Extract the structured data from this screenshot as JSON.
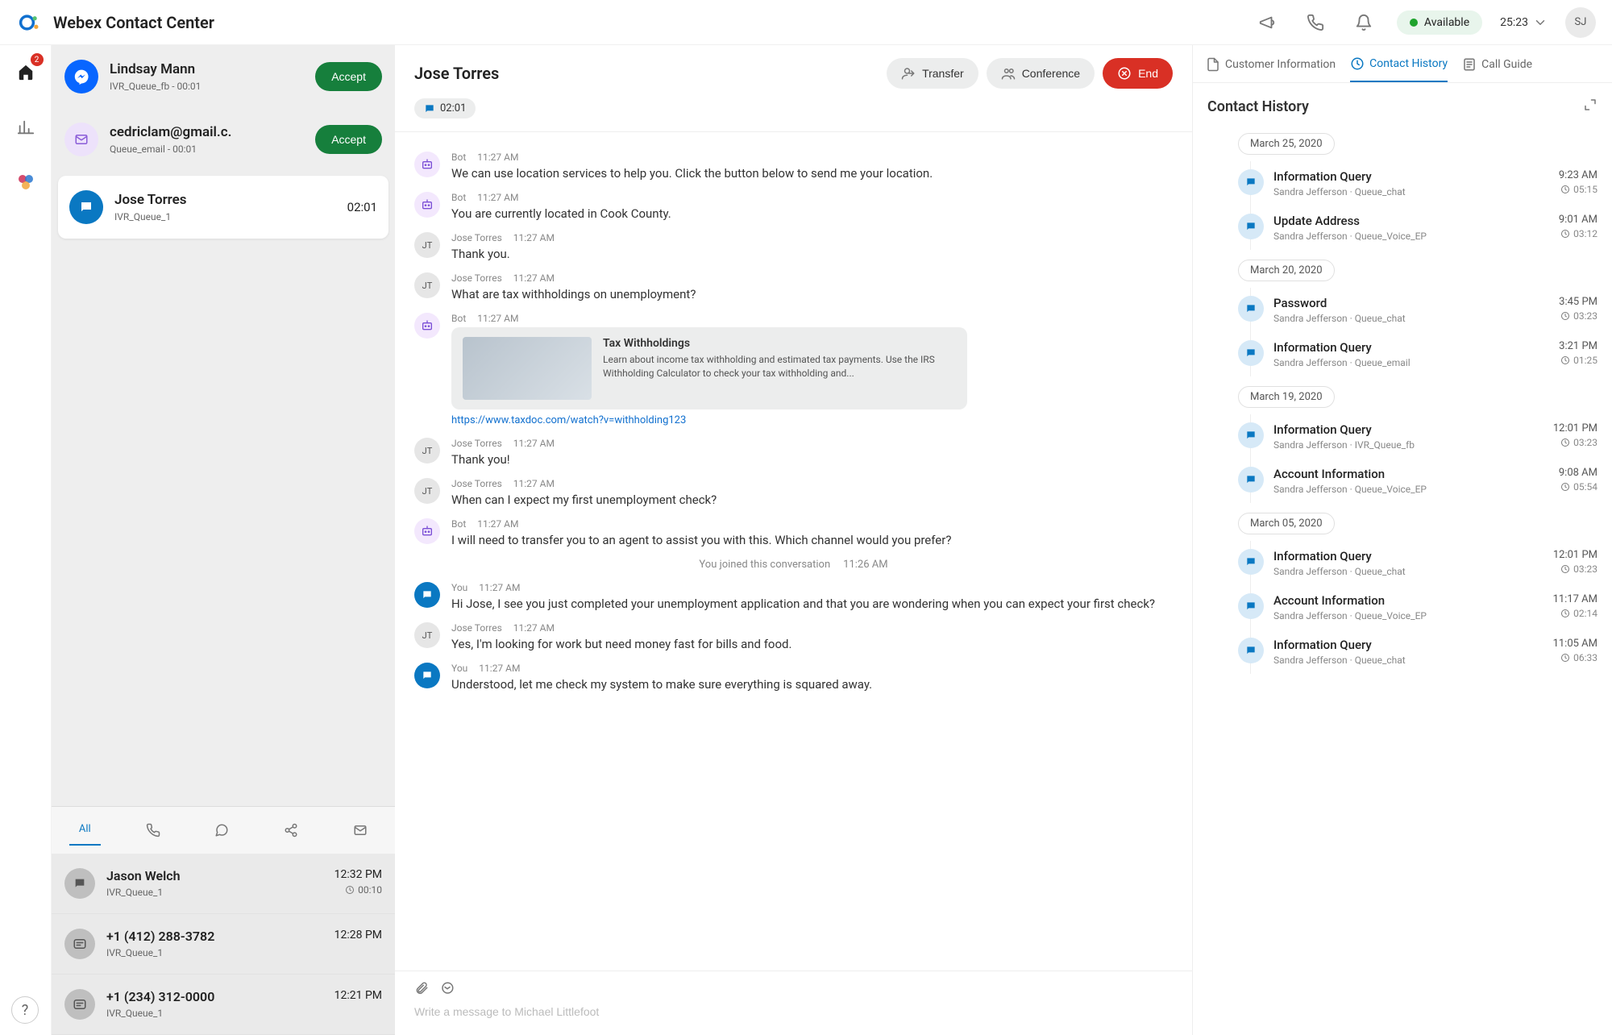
{
  "header": {
    "title": "Webex Contact Center",
    "status": "Available",
    "session_timer": "25:23",
    "user_initials": "SJ"
  },
  "rail": {
    "badge": "2"
  },
  "queue": {
    "incoming": [
      {
        "name": "Lindsay Mann",
        "sub": "IVR_Queue_fb - 00:01",
        "action": "Accept",
        "icon": "fb"
      },
      {
        "name": "cedriclam@gmail.c.",
        "sub": "Queue_email - 00:01",
        "action": "Accept",
        "icon": "mail"
      }
    ],
    "active": {
      "name": "Jose Torres",
      "sub": "IVR_Queue_1",
      "timer": "02:01"
    }
  },
  "history_tabs": {
    "active": "All"
  },
  "history": [
    {
      "name": "Jason Welch",
      "sub": "IVR_Queue_1",
      "time": "12:32 PM",
      "dur": "00:10",
      "icon": "chat"
    },
    {
      "name": "+1 (412) 288-3782",
      "sub": "IVR_Queue_1",
      "time": "12:28 PM",
      "dur": "",
      "icon": "sms"
    },
    {
      "name": "+1 (234) 312-0000",
      "sub": "IVR_Queue_1",
      "time": "12:21 PM",
      "dur": "",
      "icon": "sms"
    }
  ],
  "chat": {
    "title": "Jose Torres",
    "sub_timer": "02:01",
    "buttons": {
      "transfer": "Transfer",
      "conference": "Conference",
      "end": "End"
    },
    "composer_placeholder": "Write a message to Michael Littlefoot",
    "system_line": {
      "text": "You joined this conversation",
      "time": "11:26 AM"
    },
    "messages": [
      {
        "who": "Bot",
        "avatar": "bot",
        "time": "11:27 AM",
        "text": "We can use location services to help you.  Click the button below to send me your location."
      },
      {
        "who": "Bot",
        "avatar": "bot",
        "time": "11:27 AM",
        "text": "You are currently located in Cook County."
      },
      {
        "who": "Jose Torres",
        "avatar": "jt",
        "time": "11:27 AM",
        "text": "Thank you."
      },
      {
        "who": "Jose Torres",
        "avatar": "jt",
        "time": "11:27 AM",
        "text": "What are tax withholdings on unemployment?"
      },
      {
        "who": "Bot",
        "avatar": "bot",
        "time": "11:27 AM",
        "rich": {
          "title": "Tax Withholdings",
          "desc": "Learn about income tax withholding and estimated tax payments. Use the IRS Withholding Calculator to check your tax withholding and...",
          "link": "https://www.taxdoc.com/watch?v=withholding123"
        }
      },
      {
        "who": "Jose Torres",
        "avatar": "jt",
        "time": "11:27 AM",
        "text": "Thank you!"
      },
      {
        "who": "Jose Torres",
        "avatar": "jt",
        "time": "11:27 AM",
        "text": "When can I expect my first unemployment check?"
      },
      {
        "who": "Bot",
        "avatar": "bot",
        "time": "11:27 AM",
        "text": "I will need to transfer you to an agent to assist you with this.  Which channel would you prefer?"
      },
      {
        "system": true
      },
      {
        "who": "You",
        "avatar": "you",
        "time": "11:27 AM",
        "text": "Hi Jose, I see you just completed your unemployment application and that you are wondering when you can expect your first check?"
      },
      {
        "who": "Jose Torres",
        "avatar": "jt",
        "time": "11:27 AM",
        "text": "Yes, I'm looking for work but need money fast for bills and food."
      },
      {
        "who": "You",
        "avatar": "you",
        "time": "11:27 AM",
        "text": "Understood, let me check my system to make sure everything is squared away."
      }
    ]
  },
  "right": {
    "tabs": {
      "customer": "Customer Information",
      "history": "Contact History",
      "guide": "Call Guide"
    },
    "title": "Contact History",
    "timeline": [
      {
        "date": "March 25, 2020",
        "items": [
          {
            "title": "Information Query",
            "sub": "Sandra Jefferson · Queue_chat",
            "time": "9:23 AM",
            "dur": "05:15"
          },
          {
            "title": "Update Address",
            "sub": "Sandra Jefferson · Queue_Voice_EP",
            "time": "9:01 AM",
            "dur": "03:12"
          }
        ]
      },
      {
        "date": "March 20, 2020",
        "items": [
          {
            "title": "Password",
            "sub": "Sandra Jefferson · Queue_chat",
            "time": "3:45 PM",
            "dur": "03:23"
          },
          {
            "title": "Information Query",
            "sub": "Sandra Jefferson · Queue_email",
            "time": "3:21 PM",
            "dur": "01:25"
          }
        ]
      },
      {
        "date": "March 19, 2020",
        "items": [
          {
            "title": "Information Query",
            "sub": "Sandra Jefferson · IVR_Queue_fb",
            "time": "12:01 PM",
            "dur": "03:23"
          },
          {
            "title": "Account Information",
            "sub": "Sandra Jefferson · Queue_Voice_EP",
            "time": "9:08 AM",
            "dur": "05:54"
          }
        ]
      },
      {
        "date": "March 05, 2020",
        "items": [
          {
            "title": "Information Query",
            "sub": "Sandra Jefferson · Queue_chat",
            "time": "12:01 PM",
            "dur": "03:23"
          },
          {
            "title": "Account Information",
            "sub": "Sandra Jefferson · Queue_Voice_EP",
            "time": "11:17 AM",
            "dur": "02:14"
          },
          {
            "title": "Information Query",
            "sub": "Sandra Jefferson · Queue_chat",
            "time": "11:05 AM",
            "dur": "06:33"
          }
        ]
      }
    ]
  }
}
